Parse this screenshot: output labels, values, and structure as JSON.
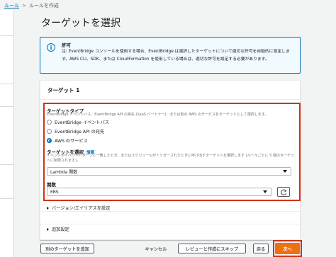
{
  "breadcrumb": {
    "rules_link": "ルール",
    "current": "ルールを作成"
  },
  "page": {
    "title": "ターゲットを選択"
  },
  "info": {
    "title": "許可",
    "text": "注: EventBridge コンソールを使用する場合、EventBridge は選択したターゲットについて適切な許可を自動的に設定します。AWS CLI、SDK、または CloudFormation を使用している場合は、適切な許可を設定する必要があります。",
    "icon": "info-icon"
  },
  "target_panel": {
    "title": "ターゲット 1",
    "target_type": {
      "label": "ターゲットタイプ",
      "description": "EventBridge イベントバス、EventBridge API の宛先 (SaaS パートナー)、または別の AWS のサービスをターゲットとして選択します。",
      "options": [
        {
          "label": "EventBridge イベントバス",
          "checked": false
        },
        {
          "label": "EventBridge API の宛先",
          "checked": false
        },
        {
          "label": "AWS のサービス",
          "checked": true
        }
      ]
    },
    "select_target": {
      "label": "ターゲットを選択",
      "info": "情報",
      "description": "イベントがイベントパターンと一致したとき、またはスケジュールがトリガーされたときに呼び出すターゲットを選択します (ルールごとに 5 個のターゲットに制限されます)。",
      "value": "Lambda 関数"
    },
    "function": {
      "label": "関数",
      "value": "EBS",
      "refresh_icon": "refresh-icon"
    },
    "expanders": {
      "version_alias": "バージョン/エイリアスを設定",
      "additional": "追加設定"
    }
  },
  "footer": {
    "add_target": "別のターゲットを追加",
    "cancel": "キャンセル",
    "review_skip": "レビューと作成にスキップ",
    "back": "戻る",
    "next": "次へ"
  },
  "colors": {
    "accent": "#0073bb",
    "primary": "#ec7211",
    "highlight": "#d13212"
  }
}
